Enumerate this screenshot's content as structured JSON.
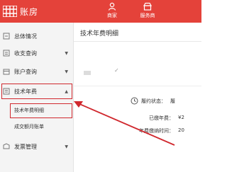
{
  "app": {
    "brand": "账房",
    "accent_color": "#e4423a",
    "highlight_color": "#d0282e"
  },
  "topnav": {
    "items": [
      {
        "label": "商家",
        "icon": "user-icon"
      },
      {
        "label": "服务商",
        "icon": "store-icon"
      }
    ]
  },
  "sidebar": {
    "items": [
      {
        "label": "总体情况",
        "icon": "home-icon"
      },
      {
        "label": "收支查询",
        "icon": "ledger-icon"
      },
      {
        "label": "账户查询",
        "icon": "account-icon"
      },
      {
        "label": "技术年费",
        "icon": "fee-icon"
      },
      {
        "label": "发票管理",
        "icon": "invoice-icon"
      }
    ],
    "subitems": [
      {
        "label": "技术年费明细"
      },
      {
        "label": "成交额月账单"
      }
    ]
  },
  "main": {
    "title": "技术年费明细",
    "status_label": "履约状态：",
    "status_value": "履",
    "paid_label": "已缴年费：",
    "paid_value": "¥2",
    "due_label": "年费缴纳时间：",
    "due_value": "20"
  }
}
